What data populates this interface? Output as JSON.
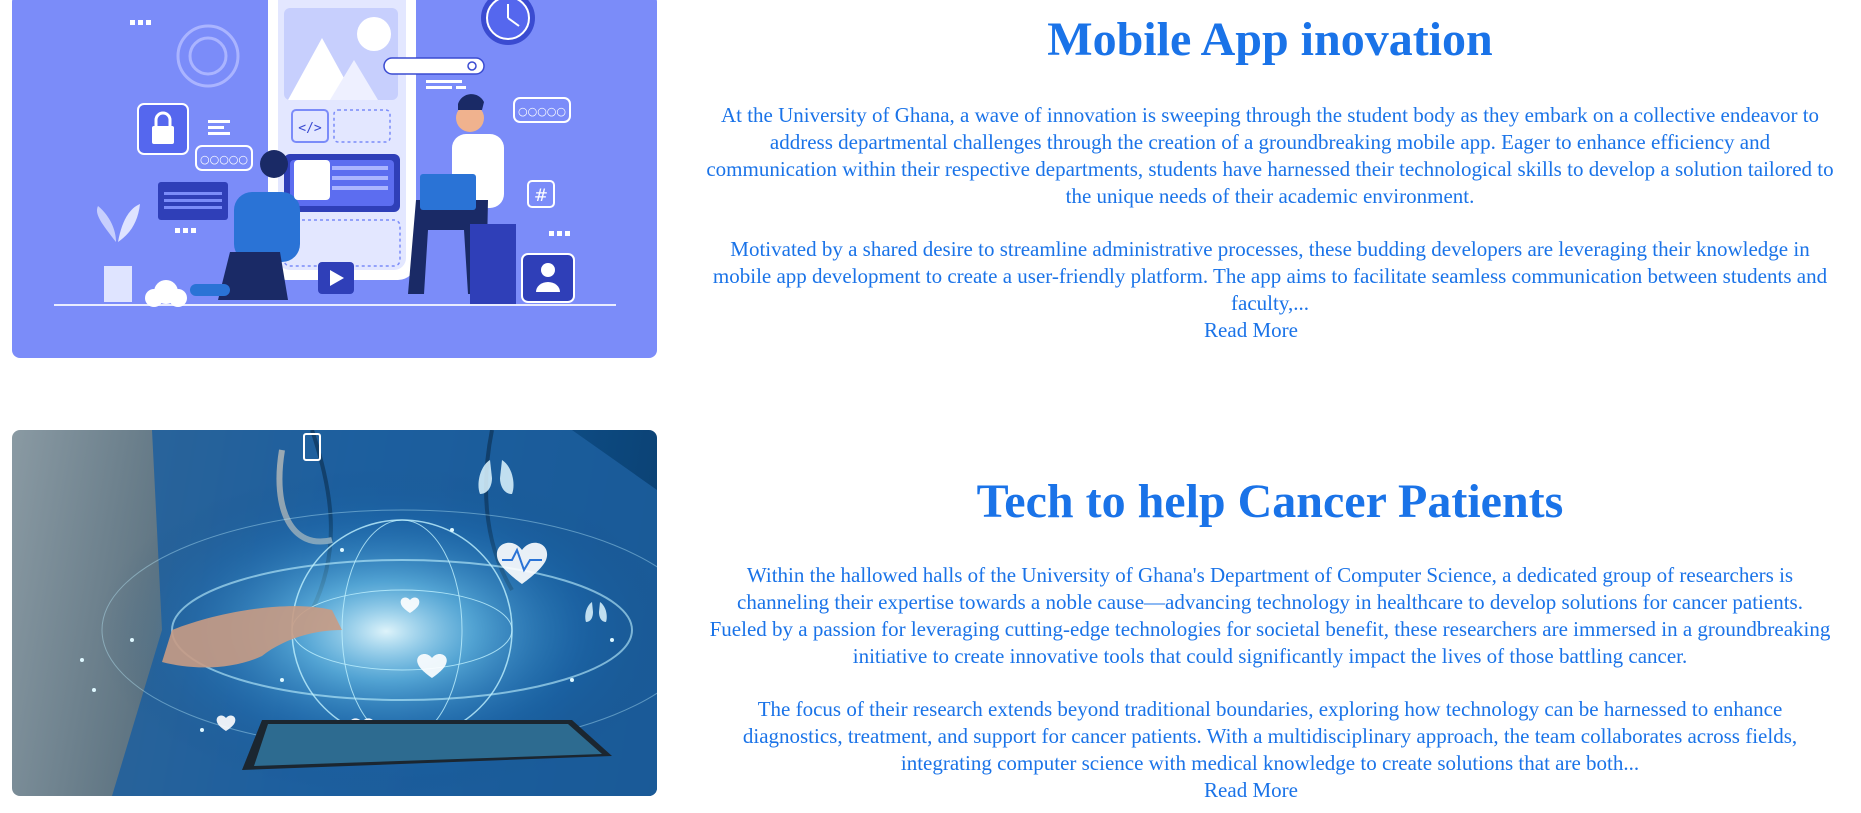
{
  "articles": [
    {
      "title": "Mobile App inovation",
      "image_alt": "Illustration of students developing a mobile app",
      "paragraphs": [
        "At the University of Ghana, a wave of innovation is sweeping through the student body as they embark on a collective endeavor to address departmental challenges through the creation of a groundbreaking mobile app. Eager to enhance efficiency and communication within their respective departments, students have harnessed their technological skills to develop a solution tailored to the unique needs of their academic environment.",
        "Motivated by a shared desire to streamline administrative processes, these budding developers are leveraging their knowledge in mobile app development to create a user-friendly platform. The app aims to facilitate seamless communication between students and faculty,..."
      ],
      "read_more": "Read More"
    },
    {
      "title": "Tech to help Cancer Patients",
      "image_alt": "Doctor holding a tablet with holographic medical globe",
      "paragraphs": [
        "Within the hallowed halls of the University of Ghana's Department of Computer Science, a dedicated group of researchers is channeling their expertise towards a noble cause—advancing technology in healthcare to develop solutions for cancer patients. Fueled by a passion for leveraging cutting-edge technologies for societal benefit, these researchers are immersed in a groundbreaking initiative to create innovative tools that could significantly impact the lives of those battling cancer.",
        "The focus of their research extends beyond traditional boundaries, exploring how technology can be harnessed to enhance diagnostics, treatment, and support for cancer patients. With a multidisciplinary approach, the team collaborates across fields, integrating computer science with medical knowledge to create solutions that are both..."
      ],
      "read_more": "Read More"
    }
  ],
  "colors": {
    "accent": "#1a73e8",
    "illustration_bg": "#7b8cf9"
  }
}
